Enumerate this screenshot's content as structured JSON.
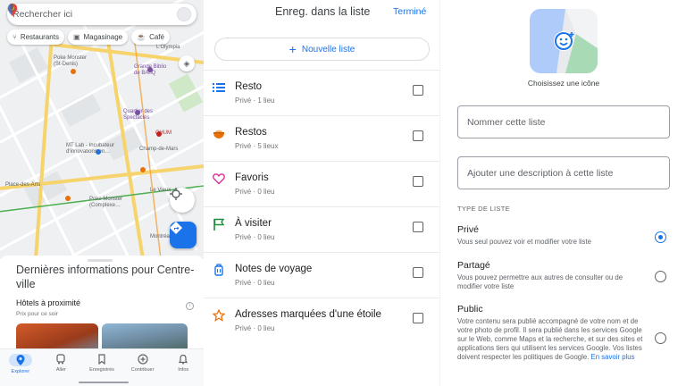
{
  "map_panel": {
    "search_placeholder": "Rechercher ici",
    "chips": [
      {
        "icon": "utensils-icon",
        "label": "Restaurants"
      },
      {
        "icon": "shopping-bag-icon",
        "label": "Magasinage"
      },
      {
        "icon": "coffee-cup-icon",
        "label": "Café"
      }
    ],
    "map_labels": {
      "poke1": "Poke Monster\n(St-Denis)",
      "grande_biblio": "Grande Biblio\nde BAnQ",
      "olympia": "L'Olympia",
      "quartier": "Quartier des\nSpectacles",
      "chum": "CHUM",
      "mtlab": "MT Lab - Incubateur\nd'innovations en…",
      "champ": "Champ-de-Mars",
      "place_arts": "Place-des-Arts",
      "poke2": "Poke Monster\n(Complexe…",
      "levieux": "Le Vieux",
      "montreal": "Montréal"
    },
    "sheet_title": "Dernières informations pour Centre-ville",
    "hotels_title": "Hôtels à proximité",
    "hotels_sub": "Prix pour ce soir",
    "nav": [
      {
        "icon": "explore-pin-icon",
        "label": "Explorer",
        "active": true
      },
      {
        "icon": "commute-icon",
        "label": "Aller",
        "active": false
      },
      {
        "icon": "bookmark-icon",
        "label": "Enregistrés",
        "active": false
      },
      {
        "icon": "add-circle-icon",
        "label": "Contribuer",
        "active": false
      },
      {
        "icon": "bell-icon",
        "label": "Infos",
        "active": false
      }
    ]
  },
  "save_panel": {
    "title": "Enreg. dans la liste",
    "done": "Terminé",
    "new_list": "Nouvelle liste",
    "lists": [
      {
        "icon": "list-icon",
        "color": "#1a73e8",
        "name": "Resto",
        "sub": "Privé · 1 lieu"
      },
      {
        "icon": "bowl-icon",
        "color": "#e8710a",
        "name": "Restos",
        "sub": "Privé · 5 lieux"
      },
      {
        "icon": "heart-icon",
        "color": "#d93091",
        "name": "Favoris",
        "sub": "Privé · 0 lieu"
      },
      {
        "icon": "flag-icon",
        "color": "#1e8e3e",
        "name": "À visiter",
        "sub": "Privé · 0 lieu"
      },
      {
        "icon": "luggage-icon",
        "color": "#1a73e8",
        "name": "Notes de voyage",
        "sub": "Privé · 0 lieu"
      },
      {
        "icon": "star-icon",
        "color": "#e8710a",
        "name": "Adresses marquées d'une étoile",
        "sub": "Privé · 0 lieu"
      }
    ]
  },
  "new_list_panel": {
    "choose_icon": "Choisissez une icône",
    "name_placeholder": "Nommer cette liste",
    "desc_placeholder": "Ajouter une description à cette liste",
    "type_header": "TYPE DE LISTE",
    "options": [
      {
        "title": "Privé",
        "desc": "Vous seul pouvez voir et modifier votre liste",
        "selected": true
      },
      {
        "title": "Partagé",
        "desc": "Vous pouvez permettre aux autres de consulter ou de modifier votre liste",
        "selected": false
      },
      {
        "title": "Public",
        "desc": "Votre contenu sera publié accompagné de votre nom et de votre photo de profil. Il sera publié dans les services Google sur le Web, comme Maps et la recherche, et sur des sites et applications tiers qui utilisent les services Google. Vos listes doivent respecter les politiques de Google.",
        "link": "En savoir plus",
        "selected": false
      }
    ]
  },
  "colors": {
    "accent": "#1a73e8",
    "text": "#202124",
    "muted": "#70757a"
  }
}
